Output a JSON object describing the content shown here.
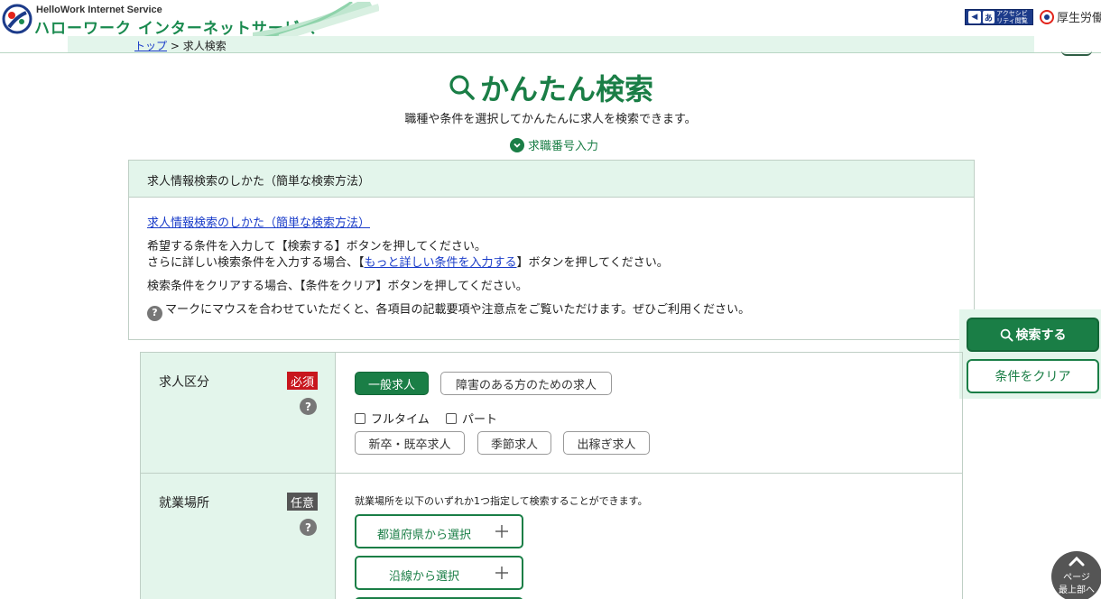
{
  "header": {
    "logo_sub": "HelloWork Internet Service",
    "logo_main": "ハローワーク インターネットサービス",
    "accessibility_label": "アクセシビリティ閲覧支援ツール",
    "ministry": "厚生労働省"
  },
  "breadcrumb": {
    "top": "トップ",
    "separator": " > ",
    "current": "求人検索"
  },
  "page": {
    "title": "かんたん検索",
    "subtitle": "職種や条件を選択してかんたんに求人を検索できます。",
    "number_input": "求職番号入力"
  },
  "info": {
    "heading": "求人情報検索のしかた（簡単な検索方法）",
    "link": "求人情報検索のしかた（簡単な検索方法）",
    "line1": "希望する条件を入力して【検索する】ボタンを押してください。",
    "line2_pre": "さらに詳しい検索条件を入力する場合、【",
    "line2_link": "もっと詳しい条件を入力する",
    "line2_post": "】ボタンを押してください。",
    "line3": "検索条件をクリアする場合、【条件をクリア】ボタンを押してください。",
    "line4": "マークにマウスを合わせていただくと、各項目の記載要項や注意点をご覧いただけます。ぜひご利用ください。",
    "help_glyph": "?"
  },
  "side": {
    "search": "検索する",
    "clear": "条件をクリア"
  },
  "form": {
    "category": {
      "label": "求人区分",
      "badge": "必須",
      "help": "?",
      "types": [
        "一般求人",
        "障害のある方のための求人"
      ],
      "selected": "一般求人",
      "checks": [
        "フルタイム",
        "パート"
      ],
      "extras": [
        "新卒・既卒求人",
        "季節求人",
        "出稼ぎ求人"
      ]
    },
    "location": {
      "label": "就業場所",
      "badge": "任意",
      "help": "?",
      "note": "就業場所を以下のいずれか1つ指定して検索することができます。",
      "buttons": [
        "都道府県から選択",
        "沿線から選択"
      ]
    }
  },
  "pagetop": {
    "line1": "ページ",
    "line2": "最上部へ"
  },
  "colors": {
    "brand_green": "#1a7e46",
    "light_green": "#e3f5eb",
    "required_red": "#c8161d"
  }
}
